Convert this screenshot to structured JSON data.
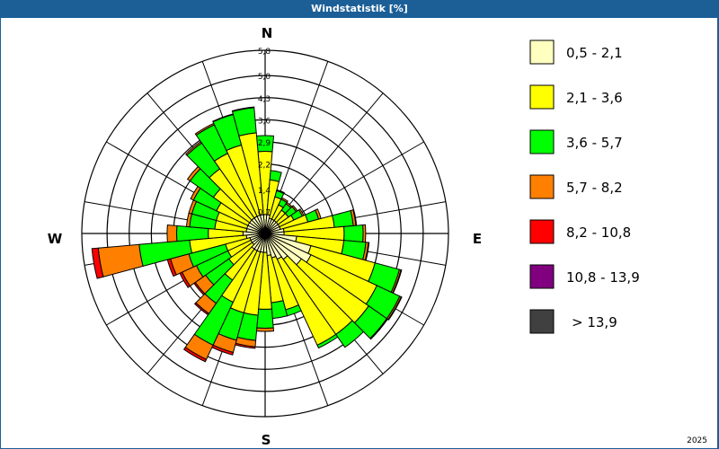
{
  "title": "Windstatistik [%]",
  "year": "2025",
  "chart_data": {
    "type": "windrose",
    "title": "Windstatistik [%]",
    "rmax": 5.8,
    "rings": [
      "0,7",
      "1,4",
      "2,2",
      "2,9",
      "3,6",
      "4,3",
      "5,0",
      "5,8"
    ],
    "ring_values": [
      0.7,
      1.4,
      2.2,
      2.9,
      3.6,
      4.3,
      5.0,
      5.8
    ],
    "compass": {
      "N": "N",
      "E": "E",
      "S": "S",
      "W": "W"
    },
    "sector_width_deg": 10,
    "directions_deg": [
      0,
      10,
      20,
      30,
      40,
      50,
      60,
      70,
      80,
      90,
      100,
      110,
      120,
      130,
      140,
      150,
      160,
      170,
      180,
      190,
      200,
      210,
      220,
      230,
      240,
      250,
      260,
      270,
      280,
      290,
      300,
      310,
      320,
      330,
      340,
      350
    ],
    "series": [
      {
        "name": "0,5 - 2,1",
        "color": "#ffffc0"
      },
      {
        "name": "2,1 - 3,6",
        "color": "#ffff00"
      },
      {
        "name": "3,6 - 5,7",
        "color": "#00ff00"
      },
      {
        "name": "5,7 - 8,2",
        "color": "#ff8000"
      },
      {
        "name": "8,2 - 10,8",
        "color": "#ff0000"
      },
      {
        "name": "10,8 - 13,9",
        "color": "#800080"
      },
      {
        "name": "> 13,9",
        "color": "#404040"
      }
    ],
    "values": [
      [
        0.6,
        2.0,
        0.5,
        0,
        0
      ],
      [
        0.6,
        1.1,
        0.3,
        0,
        0
      ],
      [
        0.5,
        0.7,
        0.2,
        0.03,
        0
      ],
      [
        0.5,
        0.5,
        0.2,
        0.05,
        0
      ],
      [
        0.5,
        0.4,
        0.25,
        0.05,
        0
      ],
      [
        0.5,
        0.4,
        0.3,
        0.05,
        0
      ],
      [
        0.5,
        0.5,
        0.3,
        0.05,
        0
      ],
      [
        0.5,
        0.9,
        0.35,
        0.08,
        0
      ],
      [
        0.6,
        1.6,
        0.6,
        0.08,
        0
      ],
      [
        0.6,
        1.9,
        0.6,
        0.08,
        0
      ],
      [
        1.0,
        1.5,
        0.7,
        0.08,
        0.02
      ],
      [
        1.5,
        2.1,
        0.8,
        0.05,
        0.02
      ],
      [
        1.6,
        2.3,
        0.8,
        0.05,
        0.02
      ],
      [
        1.4,
        2.6,
        0.7,
        0.03,
        0
      ],
      [
        1.0,
        2.9,
        0.5,
        0,
        0
      ],
      [
        0.9,
        3.0,
        0.1,
        0,
        0
      ],
      [
        0.8,
        1.7,
        0.2,
        0,
        0
      ],
      [
        0.7,
        1.5,
        0.5,
        0,
        0
      ],
      [
        0.6,
        1.8,
        0.6,
        0.1,
        0
      ],
      [
        0.6,
        2.0,
        0.8,
        0.2,
        0.05
      ],
      [
        0.6,
        2.0,
        0.9,
        0.4,
        0.08
      ],
      [
        0.6,
        1.8,
        1.5,
        0.5,
        0.08
      ],
      [
        0.6,
        1.2,
        0.9,
        0.4,
        0.05
      ],
      [
        0.5,
        0.9,
        0.9,
        0.4,
        0.05
      ],
      [
        0.5,
        0.8,
        1.1,
        0.5,
        0.08
      ],
      [
        0.5,
        0.8,
        1.2,
        0.6,
        0.1
      ],
      [
        0.6,
        1.8,
        1.6,
        1.3,
        0.2
      ],
      [
        0.7,
        1.1,
        1.0,
        0.3,
        0
      ],
      [
        0.6,
        1.0,
        0.8,
        0.1,
        0
      ],
      [
        0.6,
        1.0,
        0.8,
        0.1,
        0
      ],
      [
        0.6,
        1.1,
        0.8,
        0.1,
        0
      ],
      [
        0.6,
        1.4,
        0.9,
        0.1,
        0
      ],
      [
        0.6,
        1.9,
        1.0,
        0.05,
        0
      ],
      [
        0.6,
        2.2,
        1.0,
        0.05,
        0
      ],
      [
        0.6,
        2.3,
        1.0,
        0.02,
        0
      ],
      [
        0.6,
        2.6,
        0.8,
        0.02,
        0
      ]
    ]
  }
}
